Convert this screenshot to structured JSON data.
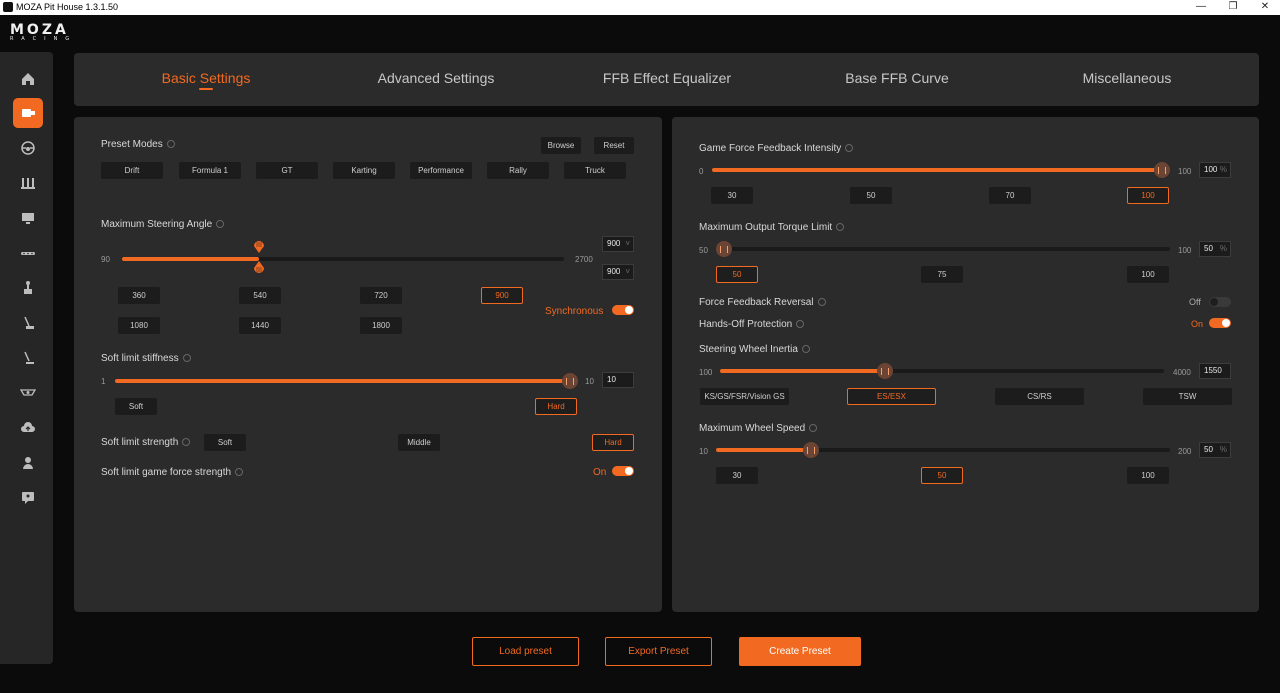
{
  "window": {
    "title": "MOZA Pit House 1.3.1.50",
    "minimize": "—",
    "restore": "❐",
    "close": "✕"
  },
  "logo": {
    "main": "MOZA",
    "sub": "RACING"
  },
  "sidebar": {
    "items": [
      {
        "name": "home-icon",
        "active": false
      },
      {
        "name": "wheelbase-icon",
        "active": true
      },
      {
        "name": "steering-wheel-icon",
        "active": false
      },
      {
        "name": "pedals-icon",
        "active": false
      },
      {
        "name": "dashboard-icon",
        "active": false
      },
      {
        "name": "handbrake-icon",
        "active": false
      },
      {
        "name": "shifter-icon",
        "active": false
      },
      {
        "name": "sequential-icon",
        "active": false
      },
      {
        "name": "h-pattern-icon",
        "active": false
      },
      {
        "name": "hub-icon",
        "active": false
      },
      {
        "name": "cloud-upload-icon",
        "active": false
      },
      {
        "name": "user-icon",
        "active": false
      },
      {
        "name": "support-icon",
        "active": false
      }
    ]
  },
  "tabs": [
    {
      "label": "Basic Settings",
      "active": true
    },
    {
      "label": "Advanced Settings",
      "active": false
    },
    {
      "label": "FFB Effect Equalizer",
      "active": false
    },
    {
      "label": "Base FFB Curve",
      "active": false
    },
    {
      "label": "Miscellaneous",
      "active": false
    }
  ],
  "left": {
    "preset_modes": {
      "label": "Preset Modes",
      "browse": "Browse",
      "reset": "Reset",
      "modes": [
        "Drift",
        "Formula 1",
        "GT",
        "Karting",
        "Performance",
        "Rally",
        "Truck"
      ]
    },
    "steering_angle": {
      "label": "Maximum Steering Angle",
      "min": "90",
      "max": "2700",
      "value_top": "900",
      "value_bottom": "900",
      "fraction": 0.31,
      "presets_row1": [
        "360",
        "540",
        "720",
        "900"
      ],
      "presets_row2": [
        "1080",
        "1440",
        "1800"
      ],
      "selected": "900",
      "sync_label": "Synchronous",
      "sync_on": true
    },
    "soft_stiffness": {
      "label": "Soft limit stiffness",
      "min": "1",
      "max": "10",
      "value": "10",
      "fraction": 1.0,
      "soft": "Soft",
      "hard": "Hard",
      "selected": "Hard"
    },
    "soft_strength": {
      "label": "Soft limit strength",
      "options": [
        "Soft",
        "Middle",
        "Hard"
      ],
      "selected": "Hard"
    },
    "soft_game_force": {
      "label": "Soft limit game force strength",
      "state": "On",
      "on": true
    }
  },
  "right": {
    "ffb_intensity": {
      "label": "Game Force Feedback Intensity",
      "min": "0",
      "max": "100",
      "value": "100",
      "unit": "%",
      "fraction": 1.0,
      "presets": [
        "30",
        "50",
        "70",
        "100"
      ],
      "selected": "100"
    },
    "torque_limit": {
      "label": "Maximum Output Torque Limit",
      "min": "50",
      "max": "100",
      "value": "50",
      "unit": "%",
      "fraction": 0.0,
      "presets": [
        "50",
        "75",
        "100"
      ],
      "selected": "50"
    },
    "ffb_reversal": {
      "label": "Force Feedback Reversal",
      "state": "Off",
      "on": false
    },
    "hands_off": {
      "label": "Hands-Off Protection",
      "state": "On",
      "on": true
    },
    "inertia": {
      "label": "Steering Wheel Inertia",
      "min": "100",
      "max": "4000",
      "value": "1550",
      "fraction": 0.372,
      "presets": [
        "KS/GS/FSR/Vision GS",
        "ES/ESX",
        "CS/RS",
        "TSW"
      ],
      "selected": "ES/ESX"
    },
    "wheel_speed": {
      "label": "Maximum Wheel Speed",
      "min": "10",
      "max": "200",
      "value": "50",
      "unit": "%",
      "fraction": 0.21,
      "presets": [
        "30",
        "50",
        "100"
      ],
      "selected": "50"
    }
  },
  "footer": {
    "load": "Load preset",
    "export": "Export Preset",
    "create": "Create Preset"
  },
  "colors": {
    "accent": "#f26a21",
    "panel": "#2b2b2b",
    "background": "#0b0b0b"
  }
}
